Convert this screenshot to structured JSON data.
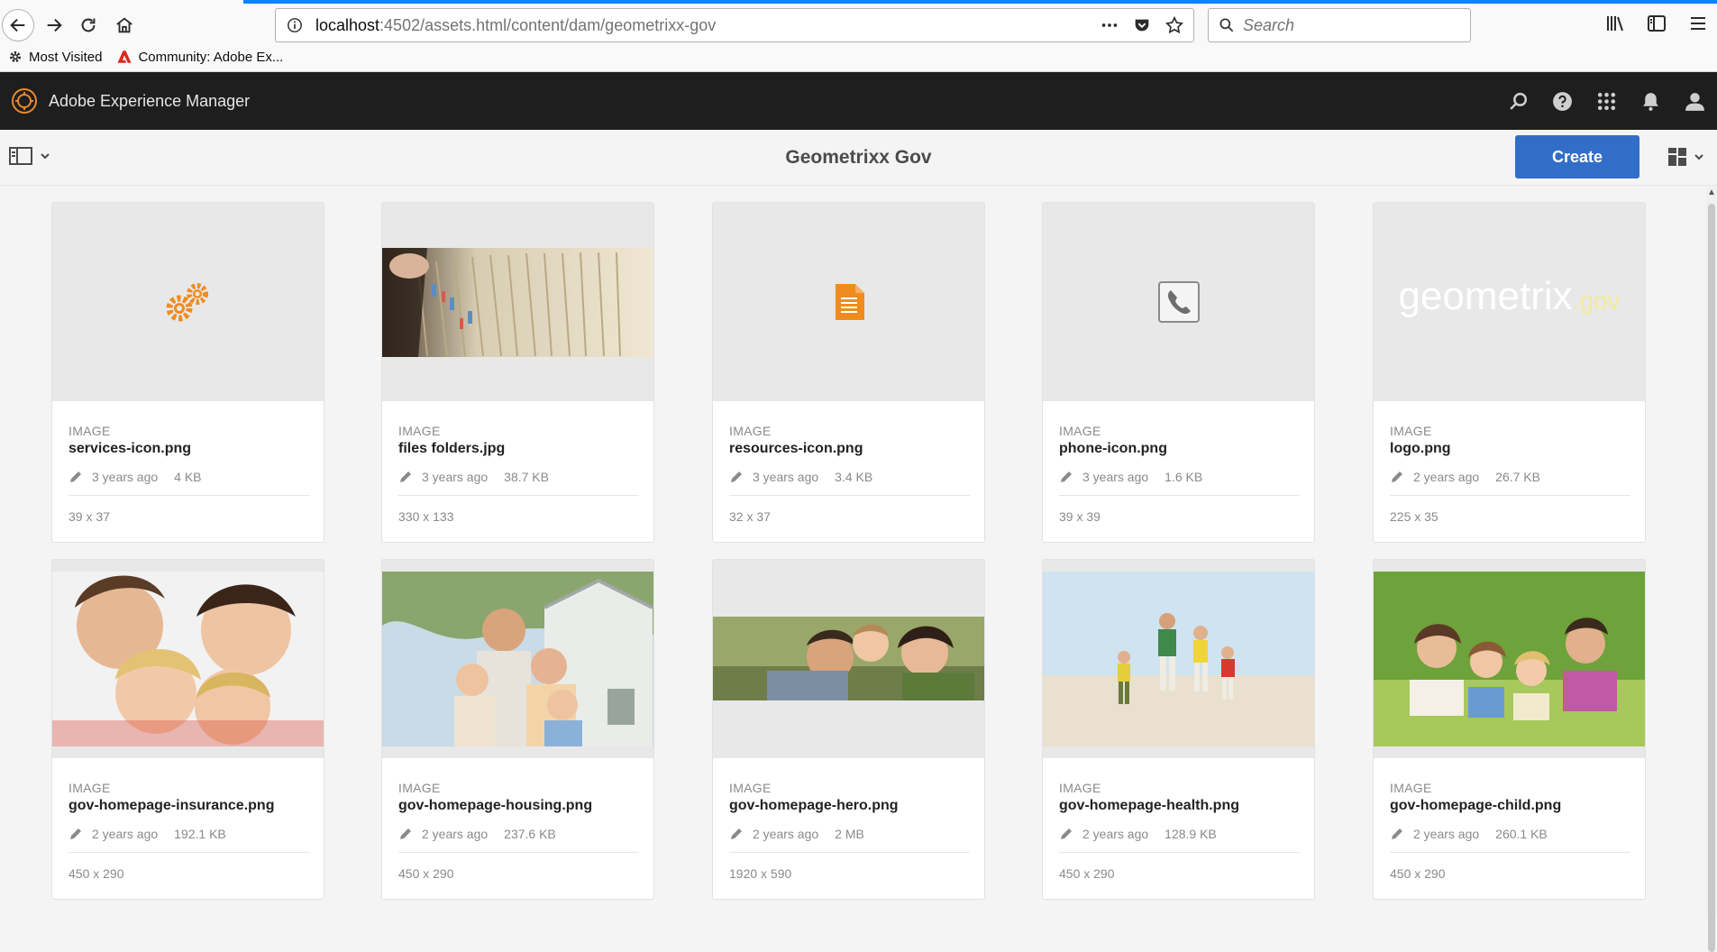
{
  "browser": {
    "url_host": "localhost",
    "url_path": ":4502/assets.html/content/dam/geometrixx-gov",
    "search_placeholder": "Search",
    "bookmarks": [
      {
        "label": "Most Visited"
      },
      {
        "label": "Community: Adobe Ex..."
      }
    ]
  },
  "app": {
    "title": "Adobe Experience Manager"
  },
  "action_bar": {
    "page_title": "Geometrixx Gov",
    "create_label": "Create"
  },
  "assets": [
    {
      "type": "IMAGE",
      "name": "services-icon.png",
      "modified": "3 years ago",
      "size": "4 KB",
      "dims": "39 x 37"
    },
    {
      "type": "IMAGE",
      "name": "files folders.jpg",
      "modified": "3 years ago",
      "size": "38.7 KB",
      "dims": "330 x 133"
    },
    {
      "type": "IMAGE",
      "name": "resources-icon.png",
      "modified": "3 years ago",
      "size": "3.4 KB",
      "dims": "32 x 37"
    },
    {
      "type": "IMAGE",
      "name": "phone-icon.png",
      "modified": "3 years ago",
      "size": "1.6 KB",
      "dims": "39 x 39"
    },
    {
      "type": "IMAGE",
      "name": "logo.png",
      "modified": "2 years ago",
      "size": "26.7 KB",
      "dims": "225 x 35",
      "logo_text": "geometrix",
      "logo_suffix": ".gov"
    },
    {
      "type": "IMAGE",
      "name": "gov-homepage-insurance.png",
      "modified": "2 years ago",
      "size": "192.1 KB",
      "dims": "450 x 290"
    },
    {
      "type": "IMAGE",
      "name": "gov-homepage-housing.png",
      "modified": "2 years ago",
      "size": "237.6 KB",
      "dims": "450 x 290"
    },
    {
      "type": "IMAGE",
      "name": "gov-homepage-hero.png",
      "modified": "2 years ago",
      "size": "2 MB",
      "dims": "1920 x 590"
    },
    {
      "type": "IMAGE",
      "name": "gov-homepage-health.png",
      "modified": "2 years ago",
      "size": "128.9 KB",
      "dims": "450 x 290"
    },
    {
      "type": "IMAGE",
      "name": "gov-homepage-child.png",
      "modified": "2 years ago",
      "size": "260.1 KB",
      "dims": "450 x 290"
    }
  ],
  "colors": {
    "accent": "#326ec8",
    "header_bg": "#1e1e1e",
    "icon_orange": "#f08c1e"
  }
}
